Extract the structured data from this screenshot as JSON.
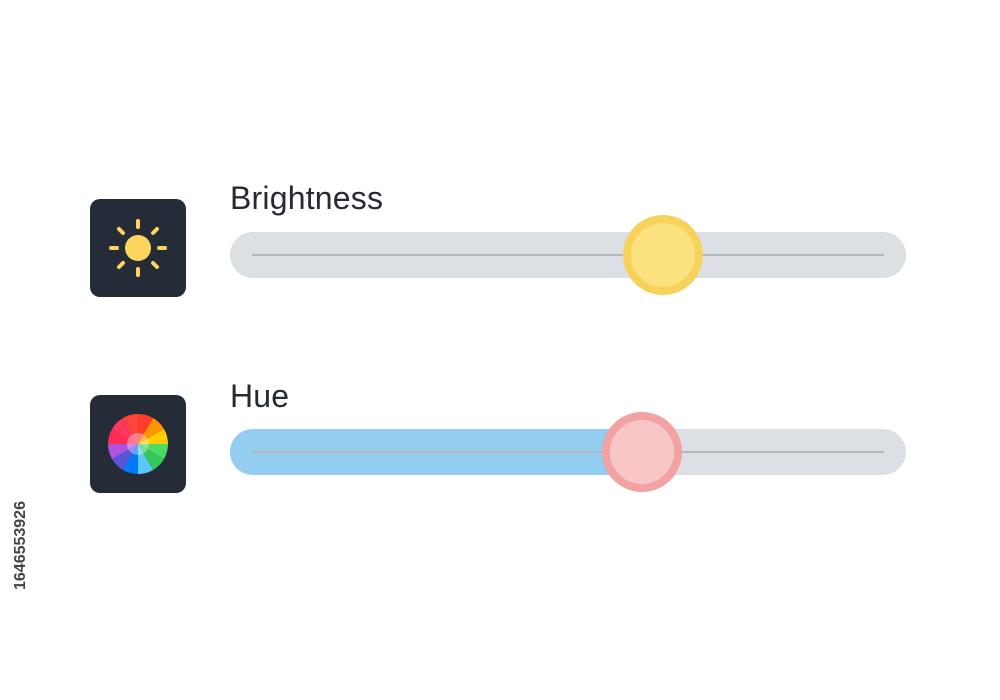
{
  "controls": [
    {
      "id": "brightness",
      "label": "Brightness",
      "icon": "sun-icon",
      "value_fraction": 0.64,
      "fill_color": null,
      "thumb_fill": "#fbe27f",
      "thumb_ring": "#f7d35c"
    },
    {
      "id": "hue",
      "label": "Hue",
      "icon": "color-wheel-icon",
      "value_fraction": 0.61,
      "fill_color": "#93cdf0",
      "thumb_fill": "#f8c6c6",
      "thumb_ring": "#f2a2a2"
    }
  ],
  "colors": {
    "icon_tile": "#252c38",
    "track": "#dcdfe3",
    "sun": "#fbd55e"
  },
  "watermark_id": "1646553926"
}
